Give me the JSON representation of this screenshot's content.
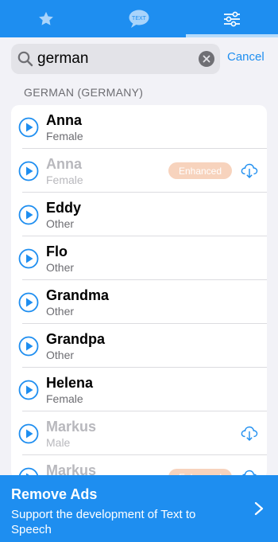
{
  "tabs": [
    {
      "icon": "star-icon",
      "selected": false
    },
    {
      "icon": "speech-bubble-text-icon",
      "label": "TEXT",
      "selected": false
    },
    {
      "icon": "sliders-icon",
      "selected": true
    }
  ],
  "search": {
    "value": "german",
    "cancel_label": "Cancel"
  },
  "section_title": "GERMAN (GERMANY)",
  "voices": [
    {
      "name": "Anna",
      "gender": "Female",
      "enabled": true
    },
    {
      "name": "Anna",
      "gender": "Female",
      "enabled": false,
      "badge": "Enhanced",
      "download": true
    },
    {
      "name": "Eddy",
      "gender": "Other",
      "enabled": true
    },
    {
      "name": "Flo",
      "gender": "Other",
      "enabled": true
    },
    {
      "name": "Grandma",
      "gender": "Other",
      "enabled": true
    },
    {
      "name": "Grandpa",
      "gender": "Other",
      "enabled": true
    },
    {
      "name": "Helena",
      "gender": "Female",
      "enabled": true
    },
    {
      "name": "Markus",
      "gender": "Male",
      "enabled": false,
      "download": true
    },
    {
      "name": "Markus",
      "gender": "",
      "enabled": false,
      "badge": "Enhanced",
      "download": true
    }
  ],
  "banner": {
    "title": "Remove Ads",
    "subtitle": "Support the development of Text to Speech"
  },
  "colors": {
    "accent": "#1e8ef0",
    "badge": "#f7d3bd"
  }
}
